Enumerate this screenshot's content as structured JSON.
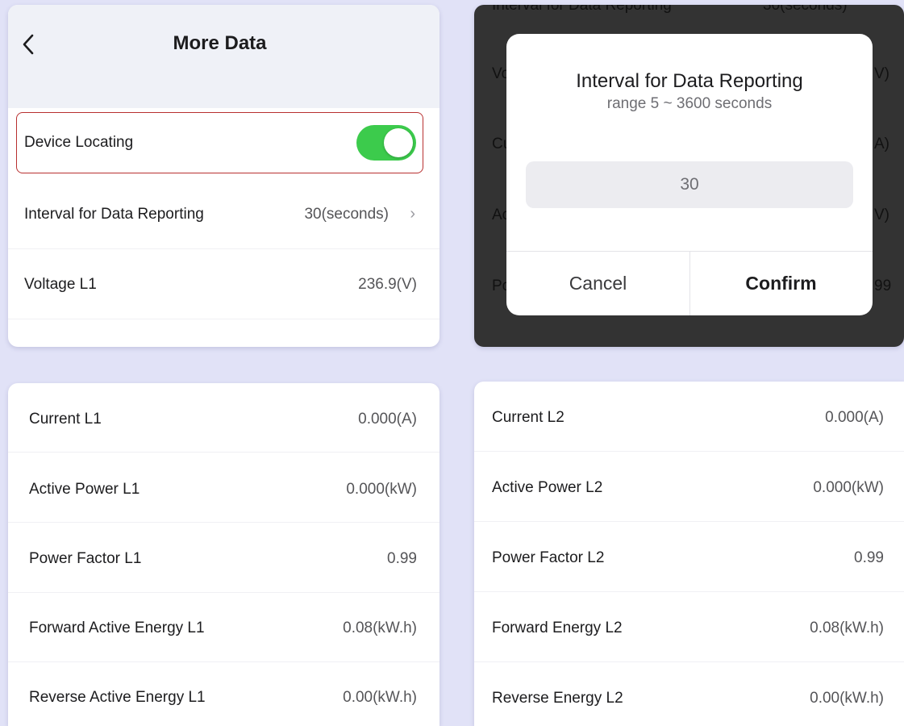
{
  "main": {
    "title": "More Data",
    "device_locating_label": "Device Locating",
    "device_locating_on": true,
    "rows": [
      {
        "label": "Interval for Data Reporting",
        "value": "30(seconds)"
      },
      {
        "label": "Voltage L1",
        "value": "236.9(V)"
      }
    ]
  },
  "dialog": {
    "title": "Interval for Data Reporting",
    "subtitle": "range 5 ~ 3600 seconds",
    "input_value": "30",
    "cancel_label": "Cancel",
    "confirm_label": "Confirm",
    "background_fragments": [
      "Interval for Data Reporting",
      "30(seconds)",
      "Vo",
      "V)",
      "Cu",
      "A)",
      "Ac",
      "V)",
      "Po",
      "99"
    ]
  },
  "card_l1": {
    "rows": [
      {
        "label": "Current L1",
        "value": "0.000(A)"
      },
      {
        "label": "Active Power L1",
        "value": "0.000(kW)"
      },
      {
        "label": "Power Factor L1",
        "value": "0.99"
      },
      {
        "label": "Forward Active Energy L1",
        "value": "0.08(kW.h)"
      },
      {
        "label": "Reverse Active Energy L1",
        "value": "0.00(kW.h)"
      }
    ]
  },
  "card_l2": {
    "rows": [
      {
        "label": "Current L2",
        "value": "0.000(A)"
      },
      {
        "label": "Active Power L2",
        "value": "0.000(kW)"
      },
      {
        "label": "Power Factor L2",
        "value": "0.99"
      },
      {
        "label": "Forward Energy L2",
        "value": "0.08(kW.h)"
      },
      {
        "label": "Reverse Energy L2",
        "value": "0.00(kW.h)"
      }
    ]
  },
  "colors": {
    "toggle_on": "#3ccb4c",
    "highlight_border": "#b83030",
    "page_bg": "#e1e2f7"
  }
}
